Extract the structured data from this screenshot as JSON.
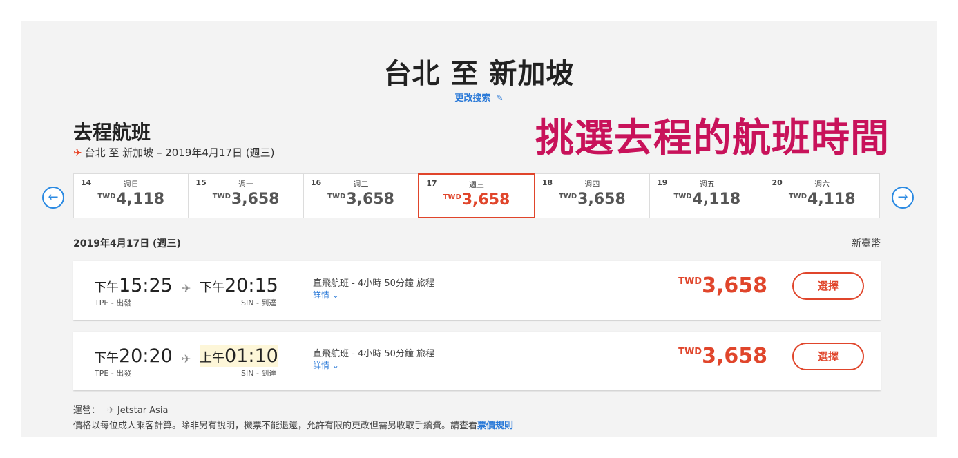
{
  "header": {
    "route_title": "台北 至 新加坡",
    "modify_search": "更改搜索",
    "pencil_icon": "✎"
  },
  "section": {
    "title": "去程航班",
    "origin": "台北",
    "to": "至",
    "destination": "新加坡",
    "date_suffix": " – 2019年4月17日 (週三)",
    "plane_icon": "✈"
  },
  "annotation": "挑選去程的航班時間",
  "nav": {
    "prev": "←",
    "next": "→"
  },
  "date_strip": [
    {
      "num": "14",
      "dow": "週日",
      "currency": "TWD",
      "price": "4,118"
    },
    {
      "num": "15",
      "dow": "週一",
      "currency": "TWD",
      "price": "3,658"
    },
    {
      "num": "16",
      "dow": "週二",
      "currency": "TWD",
      "price": "3,658"
    },
    {
      "num": "17",
      "dow": "週三",
      "currency": "TWD",
      "price": "3,658"
    },
    {
      "num": "18",
      "dow": "週四",
      "currency": "TWD",
      "price": "3,658"
    },
    {
      "num": "19",
      "dow": "週五",
      "currency": "TWD",
      "price": "4,118"
    },
    {
      "num": "20",
      "dow": "週六",
      "currency": "TWD",
      "price": "4,118"
    }
  ],
  "list": {
    "date": "2019年4月17日 (週三)",
    "currency_label": "新臺幣"
  },
  "flights": [
    {
      "dep_ampm": "下午",
      "dep_time": "15:25",
      "dep_label": "TPE - 出發",
      "arr_ampm": "下午",
      "arr_time": "20:15",
      "arr_label": "SIN - 到達",
      "info": "直飛航班 - 4小時 50分鐘 旅程",
      "details": "詳情 ⌄",
      "currency": "TWD",
      "price": "3,658",
      "select": "選擇"
    },
    {
      "dep_ampm": "下午",
      "dep_time": "20:20",
      "dep_label": "TPE - 出發",
      "arr_ampm": "上午",
      "arr_time": "01:10",
      "arr_label": "SIN - 到達",
      "info": "直飛航班 - 4小時 50分鐘 旅程",
      "details": "詳情 ⌄",
      "currency": "TWD",
      "price": "3,658",
      "select": "選擇"
    }
  ],
  "footer": {
    "operator_label": "運營：",
    "operator_name": "Jetstar Asia",
    "disclaimer": "價格以每位成人乘客計算。除非另有說明，機票不能退還，允許有限的更改但需另收取手續費。請查看",
    "fare_rules": "票價規則"
  },
  "colors": {
    "accent": "#e0452b",
    "link": "#2b7ad8",
    "annotation": "#c8125a",
    "panel_bg": "#f3f3f3"
  }
}
